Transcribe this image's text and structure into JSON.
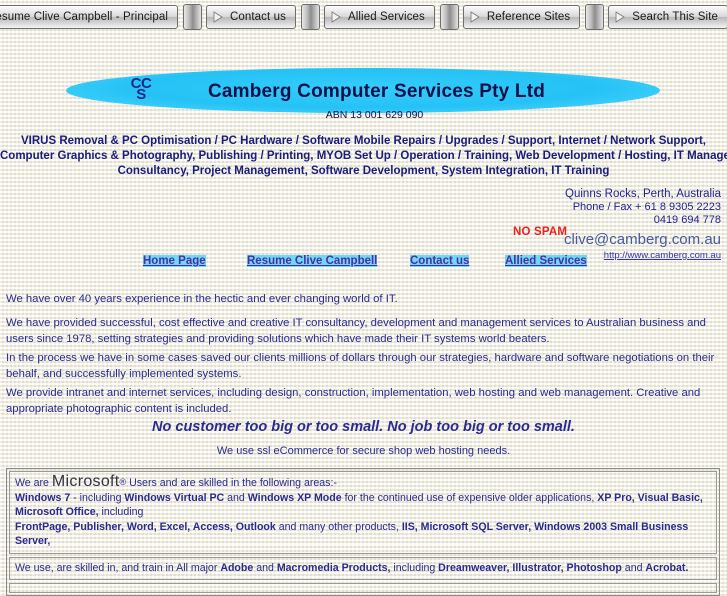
{
  "nav": {
    "tabs": [
      {
        "label": "Resume Clive Campbell - Principal"
      },
      {
        "label": "Contact us"
      },
      {
        "label": "Allied Services"
      },
      {
        "label": "Reference Sites"
      },
      {
        "label": "Search This Site"
      }
    ]
  },
  "header": {
    "logo_line1": "CC",
    "logo_line2": "S",
    "company_name": "Camberg  Computer Services Pty Ltd",
    "abn": "ABN 13 001 629 090",
    "ellipse_color": "#29c5f6",
    "title_color": "#10104a"
  },
  "services": {
    "line1": "VIRUS Removal & PC Optimisation / PC Hardware / Software Mobile Repairs / Upgrades / Support,  Internet / Network Support,",
    "line2": "Computer Graphics & Photography,  Publishing / Printing, MYOB Set Up / Operation / Training,  Web Development / Hosting,  IT Management /",
    "line3": "Consultancy,  Project Management, Software Development,  System Integration,  IT Training"
  },
  "contact": {
    "address": "Quinns Rocks, Perth, Australia",
    "phone": "Phone / Fax  + 61 8 9305 2223",
    "mobile": "0419 694 778",
    "email": "clive@camberg.com.au",
    "website": "http://www.camberg.com.au",
    "no_spam": "NO SPAM",
    "no_spam_color": "#e8211c"
  },
  "links": {
    "home": "Home Page",
    "resume": "Resume Clive Campbell",
    "contact": "Contact us",
    "allied": "Allied Services",
    "highlight_color": "#6fd8f5"
  },
  "body": {
    "p1": "We have over 40 years experience in the hectic and ever changing world of IT.",
    "p2": "We have provided successful, cost effective and creative IT consultancy, development and management services to Australian business and users since 1978, setting strategies and providing solutions which have made their IT systems world beaters.",
    "p3": "In the process we have in some cases saved our clients millions of dollars through our strategies,  hardware and software negotiations on their behalf, and successfully implemented systems.",
    "p4": "We provide intranet and internet services, including design, construction, implementation, web hosting and  web management. Creative and appropriate photographic content is included.",
    "tagline": "No customer too big or too small.   No job too big or too small.",
    "ssl_line": "We use ssl eCommerce for secure shop web hosting needs."
  },
  "boxes": {
    "ms_intro_pre": "We are ",
    "ms_word": "Microsoft",
    "ms_reg": "®",
    "ms_intro_post": " Users and are skilled in the following areas:-",
    "ms_line2_a": "Windows 7",
    "ms_line2_b": " - including ",
    "ms_line2_c": "Windows Virtual PC",
    "ms_line2_d": " and ",
    "ms_line2_e": "Windows XP Mode",
    "ms_line2_f": " for the continued use of expensive older applications,  ",
    "ms_line2_g": "XP Pro, Visual Basic, Microsoft Office,",
    "ms_line2_h": " including",
    "ms_line3_a": "FrontPage, Publisher, Word, Excel, Access, Outlook",
    "ms_line3_b": " and many other products, ",
    "ms_line3_c": "IIS, Microsoft SQL Server, Windows 2003 Small Business Server,",
    "adobe_a": "We use, are skilled in, and train in All major ",
    "adobe_b": "Adobe",
    "adobe_c": " and ",
    "adobe_d": "Macromedia Products,",
    "adobe_e": " including ",
    "adobe_f": "Dreamweaver, Illustrator, Photoshop",
    "adobe_g": " and ",
    "adobe_h": "Acrobat."
  }
}
